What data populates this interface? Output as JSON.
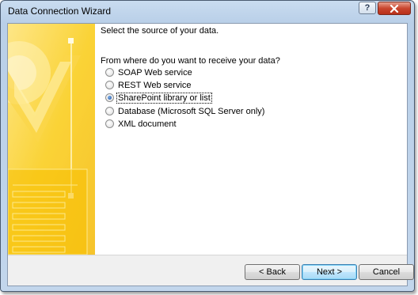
{
  "window": {
    "title": "Data Connection Wizard",
    "help_label": "?"
  },
  "wizard": {
    "heading": "Select the source of your data.",
    "question": "From where do you want to receive your data?",
    "options": [
      {
        "label": "SOAP Web service",
        "selected": false
      },
      {
        "label": "REST Web service",
        "selected": false
      },
      {
        "label": "SharePoint library or list",
        "selected": true
      },
      {
        "label": "Database (Microsoft SQL Server only)",
        "selected": false
      },
      {
        "label": "XML document",
        "selected": false
      }
    ]
  },
  "buttons": {
    "back": "< Back",
    "next": "Next >",
    "cancel": "Cancel"
  },
  "colors": {
    "art_yellow": "#f9c80e",
    "accent_blue": "#3c7fb1"
  },
  "icons": [
    "help-icon",
    "close-icon",
    "wizard-art-graphic"
  ]
}
